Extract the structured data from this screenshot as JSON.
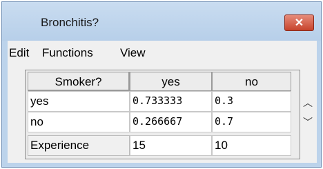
{
  "window": {
    "title": "Bronchitis?"
  },
  "menu": {
    "items": [
      "Edit",
      "Functions",
      "View"
    ]
  },
  "table": {
    "parent_label": "Smoker?",
    "columns": [
      "yes",
      "no"
    ],
    "rows": [
      {
        "label": "yes",
        "values": [
          "0.733333",
          "0.3"
        ]
      },
      {
        "label": "no",
        "values": [
          "0.266667",
          "0.7"
        ]
      }
    ],
    "experience": {
      "label": "Experience",
      "values": [
        "15",
        "10"
      ]
    }
  },
  "icons": {
    "close": "close-icon",
    "up": "scroll-up-icon",
    "down": "scroll-down-icon"
  }
}
